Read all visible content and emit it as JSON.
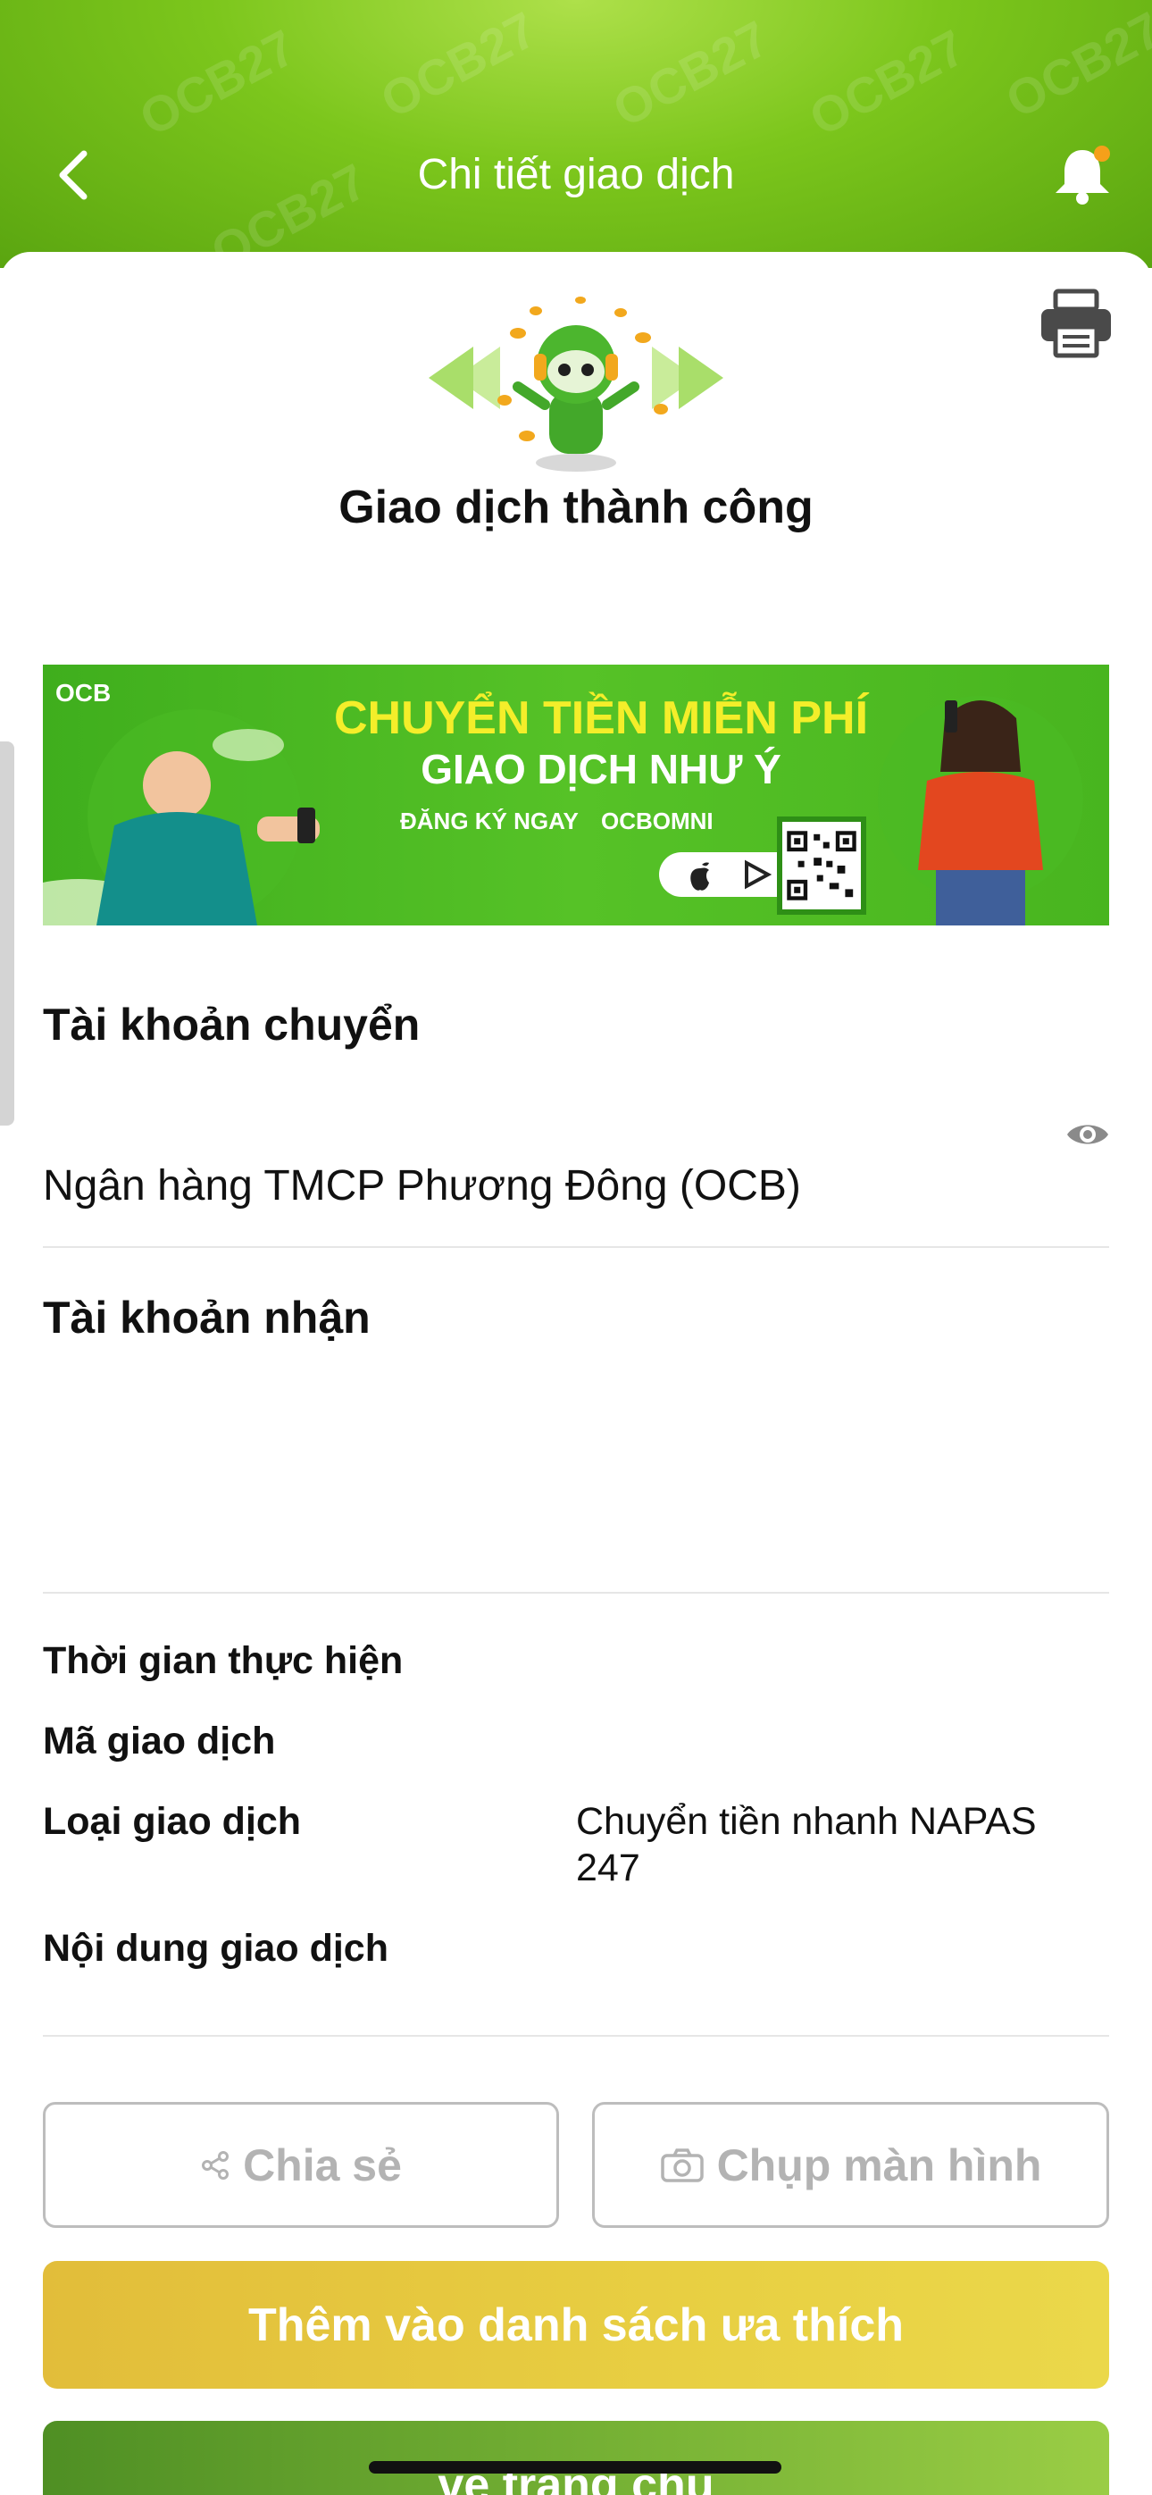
{
  "header": {
    "title": "Chi tiết giao dịch",
    "watermark_text": "OCB27",
    "background_color": "#7cc61c"
  },
  "status": {
    "title": "Giao dịch thành công"
  },
  "banner": {
    "logo_text": "OCB",
    "line1": "CHUYỂN TIỀN MIỄN PHÍ",
    "line2": "GIAO DỊCH NHƯ Ý",
    "cta": "ĐĂNG KÝ NGAY",
    "brand": "OCBOMNI"
  },
  "source_account": {
    "title": "Tài khoản chuyển",
    "bank_name": "Ngân hàng TMCP Phương Đông (OCB)"
  },
  "destination_account": {
    "title": "Tài khoản nhận"
  },
  "details": {
    "time_label": "Thời gian thực hiện",
    "code_label": "Mã giao dịch",
    "type_label": "Loại giao dịch",
    "type_value": "Chuyển tiền nhanh NAPAS 247",
    "content_label": "Nội dung giao dịch"
  },
  "actions": {
    "share_label": "Chia sẻ",
    "capture_label": "Chụp màn hình",
    "favorite_label": "Thêm vào danh sách ưa thích",
    "home_label": "về trang chủ"
  },
  "icons": {
    "back": "back-arrow-icon",
    "bell": "bell-icon",
    "print": "printer-icon",
    "eye": "eye-icon",
    "share": "share-icon",
    "camera": "camera-icon"
  },
  "colors": {
    "accent_green": "#6fbd1f",
    "favorite_yellow": "#e6c83f",
    "home_green": "#77b235",
    "notification_dot": "#f5a01a"
  }
}
